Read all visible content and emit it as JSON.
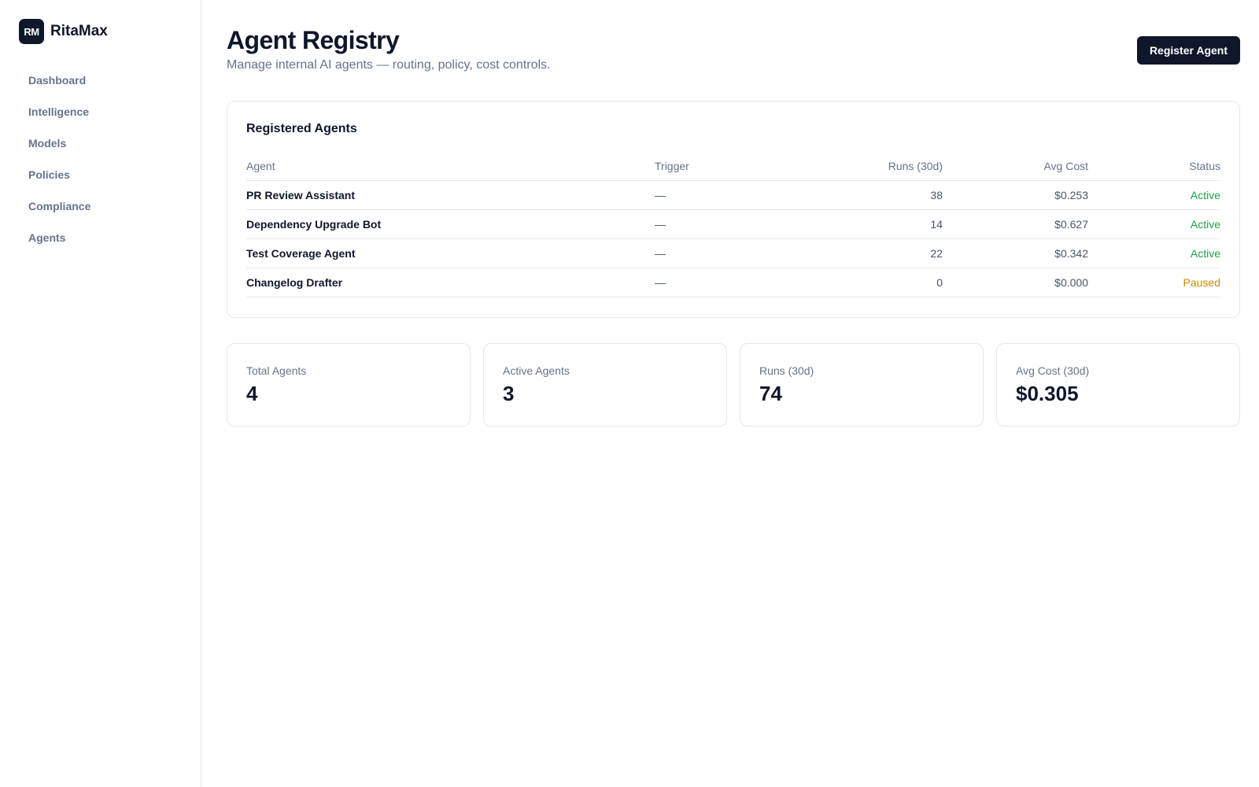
{
  "brand": {
    "logo": "RM",
    "name": "RitaMax"
  },
  "sidebar": {
    "items": [
      {
        "label": "Dashboard"
      },
      {
        "label": "Intelligence"
      },
      {
        "label": "Models"
      },
      {
        "label": "Policies"
      },
      {
        "label": "Compliance"
      },
      {
        "label": "Agents"
      }
    ]
  },
  "header": {
    "title": "Agent Registry",
    "subtitle": "Manage internal AI agents — routing, policy, cost controls.",
    "register_button": "Register Agent"
  },
  "table": {
    "title": "Registered Agents",
    "columns": [
      "Agent",
      "Trigger",
      "Runs (30d)",
      "Avg Cost",
      "Status"
    ],
    "rows": [
      {
        "agent": "PR Review Assistant",
        "trigger": "—",
        "runs": "38",
        "cost": "$0.253",
        "status": "Active"
      },
      {
        "agent": "Dependency Upgrade Bot",
        "trigger": "—",
        "runs": "14",
        "cost": "$0.627",
        "status": "Active"
      },
      {
        "agent": "Test Coverage Agent",
        "trigger": "—",
        "runs": "22",
        "cost": "$0.342",
        "status": "Active"
      },
      {
        "agent": "Changelog Drafter",
        "trigger": "—",
        "runs": "0",
        "cost": "$0.000",
        "status": "Paused"
      }
    ]
  },
  "stats": [
    {
      "label": "Total Agents",
      "value": "4"
    },
    {
      "label": "Active Agents",
      "value": "3"
    },
    {
      "label": "Runs (30d)",
      "value": "74"
    },
    {
      "label": "Avg Cost (30d)",
      "value": "$0.305"
    }
  ],
  "colors": {
    "primary": "#0f172a",
    "muted": "#64748b",
    "border": "#e5e7eb",
    "status_active": "#16a34a",
    "status_paused": "#ca8a04"
  }
}
